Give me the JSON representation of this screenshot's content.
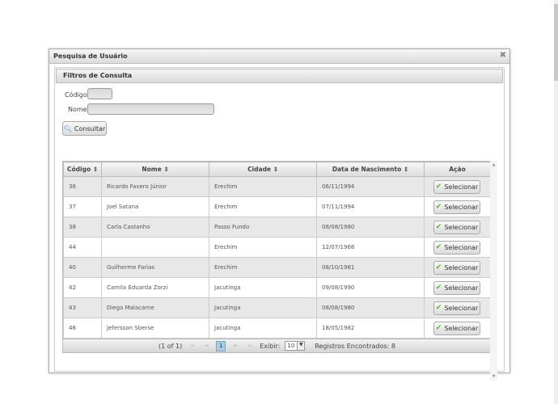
{
  "dialog": {
    "title": "Pesquisa de Usuário",
    "close_icon": "close-icon"
  },
  "filters": {
    "title": "Filtros de Consulta",
    "codigo_label": "Código:",
    "codigo_value": "",
    "nome_label": "Nome:",
    "nome_value": "",
    "consultar": "Consultar"
  },
  "table": {
    "headers": [
      "Código ⇕",
      "Nome ⇕",
      "Cidade ⇕",
      "Data de Nascimento ⇕",
      "Ação"
    ],
    "rows": [
      {
        "codigo": "36",
        "nome": "Ricardo Favero Júnior",
        "cidade": "Erechim",
        "data": "06/11/1994",
        "acao": "Selecionar"
      },
      {
        "codigo": "37",
        "nome": "Joel Satana",
        "cidade": "Erechim",
        "data": "07/11/1994",
        "acao": "Selecionar"
      },
      {
        "codigo": "38",
        "nome": "Carla Castanho",
        "cidade": "Passo Fundo",
        "data": "08/08/1980",
        "acao": "Selecionar"
      },
      {
        "codigo": "44",
        "nome": "",
        "cidade": "Erechim",
        "data": "12/07/1968",
        "acao": "Selecionar"
      },
      {
        "codigo": "40",
        "nome": "Guilherme Farias",
        "cidade": "Erechim",
        "data": "08/10/1981",
        "acao": "Selecionar"
      },
      {
        "codigo": "42",
        "nome": "Camila Eduarda Zorzi",
        "cidade": "Jacutinga",
        "data": "09/08/1990",
        "acao": "Selecionar"
      },
      {
        "codigo": "43",
        "nome": "Diego Malacarne",
        "cidade": "Jacutinga",
        "data": "08/08/1980",
        "acao": "Selecionar"
      },
      {
        "codigo": "46",
        "nome": "Jefersson Sberse",
        "cidade": "Jacutinga",
        "data": "18/05/1982",
        "acao": "Selecionar"
      }
    ]
  },
  "pager": {
    "info": "(1 of 1)",
    "first": "|◂",
    "prev": "◂◂",
    "current": "1",
    "next": "▸▸",
    "last": "▸|",
    "exibir_label": "Exibir:",
    "rows_per_page": "10",
    "registros": "Registros Encontrados: 8"
  }
}
